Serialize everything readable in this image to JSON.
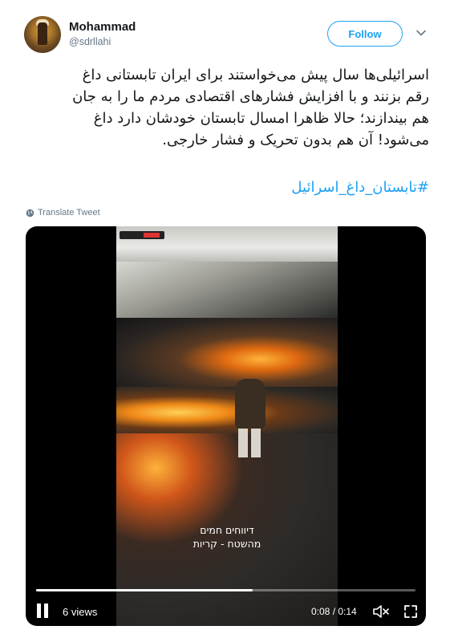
{
  "user": {
    "name": "Mohammad",
    "handle": "@sdrllahi"
  },
  "follow_label": "Follow",
  "tweet": {
    "lines": [
      "اسرائیلی‌ها سال پیش می‌خواستند برای ایران تابستانی داغ",
      "رقم بزنند و با افزایش فشارهای اقتصادی مردم ما را به جان",
      "هم بیندازند؛ حالا ظاهرا امسال تابستان خودشان دارد داغ",
      "می‌شود! آن هم بدون تحریک و فشار خارجی."
    ],
    "hashtag": "#تابستان_داغ_اسرائیل"
  },
  "translate_label": "Translate Tweet",
  "video": {
    "caption_lines": [
      "דיווחים חמים",
      "מהשטח - קריות"
    ],
    "views": "6 views",
    "time": "0:08 / 0:14",
    "progress_fraction": 0.571
  },
  "icons": {
    "chevron": "chevron-down-icon",
    "globe": "globe-icon",
    "pause": "pause-icon",
    "mute": "mute-icon",
    "fullscreen": "fullscreen-icon"
  },
  "colors": {
    "accent": "#1da1f2",
    "secondary_text": "#657786"
  }
}
